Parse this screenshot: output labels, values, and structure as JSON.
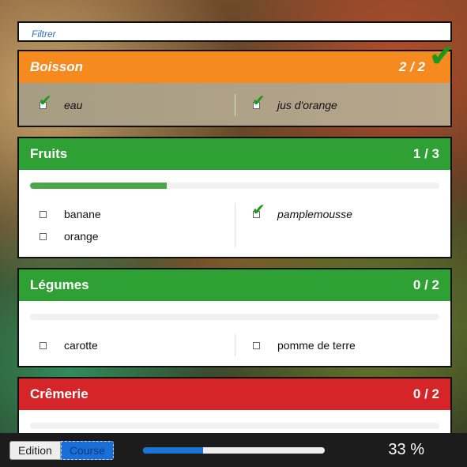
{
  "filter": {
    "placeholder": "Filtrer"
  },
  "categories": [
    {
      "title": "Boisson",
      "count": "2 / 2",
      "progress": 1.0,
      "items_left": [
        {
          "label": "eau",
          "checked": true
        }
      ],
      "items_right": [
        {
          "label": "jus d'orange",
          "checked": true
        }
      ]
    },
    {
      "title": "Fruits",
      "count": "1 / 3",
      "progress": 0.3333,
      "items_left": [
        {
          "label": "banane",
          "checked": false
        },
        {
          "label": "orange",
          "checked": false
        }
      ],
      "items_right": [
        {
          "label": "pamplemousse",
          "checked": true
        }
      ]
    },
    {
      "title": "Légumes",
      "count": "0 / 2",
      "progress": 0,
      "items_left": [
        {
          "label": "carotte",
          "checked": false
        }
      ],
      "items_right": [
        {
          "label": "pomme de terre",
          "checked": false
        }
      ]
    },
    {
      "title": "Crêmerie",
      "count": "0 / 2",
      "progress": 0
    }
  ],
  "footer": {
    "edit_label": "Edition",
    "course_label": "Course",
    "progress": 0.33,
    "percent_text": "33 %"
  },
  "colors": {
    "done": "#f58a1f",
    "active": "#2ea034",
    "empty": "#d62528",
    "check": "#1a9a1a",
    "accent": "#1a74d4"
  },
  "icons": {
    "check": "check-icon",
    "checkbox": "checkbox-icon"
  }
}
